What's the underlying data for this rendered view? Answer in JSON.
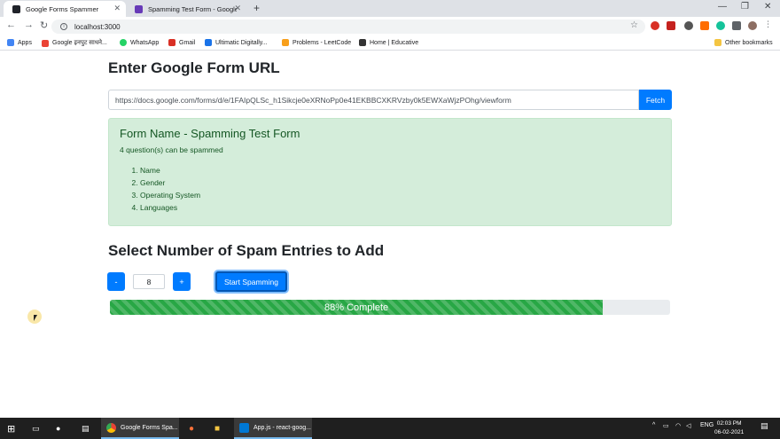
{
  "browser": {
    "tabs": [
      {
        "title": "Google Forms Spammer",
        "active": true
      },
      {
        "title": "Spamming Test Form - Google F",
        "active": false
      }
    ],
    "url": "localhost:3000",
    "bookmarks": [
      "Apps",
      "Google इनपुट साधने...",
      "WhatsApp",
      "Gmail",
      "Ultimatic Digitally...",
      "Problems - LeetCode",
      "Home | Educative",
      "Other bookmarks"
    ]
  },
  "page": {
    "url_heading": "Enter Google Form URL",
    "form_url_value": "https://docs.google.com/forms/d/e/1FAIpQLSc_h1Sikcje0eXRNoPp0e41EKBBCXKRVzby0k5EWXaWjzPOhg/viewform",
    "fetch_label": "Fetch",
    "form_name": "Form Name - Spamming Test Form",
    "question_count": "4 question(s) can be spammed",
    "questions": [
      "Name",
      "Gender",
      "Operating System",
      "Languages"
    ],
    "spam_heading": "Select Number of Spam Entries to Add",
    "decrement_label": "-",
    "increment_label": "+",
    "entries_value": "8",
    "start_label": "Start Spamming",
    "progress_percent": 88,
    "progress_label": "88% Complete"
  },
  "taskbar": {
    "apps": [
      "Google Forms Spa...",
      "App.js - react-goog..."
    ],
    "language": "ENG",
    "time": "02:03 PM",
    "date": "06-02-2021"
  },
  "colors": {
    "primary": "#007bff",
    "success_bg": "#d4edda",
    "success_text": "#155724",
    "progress": "#28a745"
  }
}
